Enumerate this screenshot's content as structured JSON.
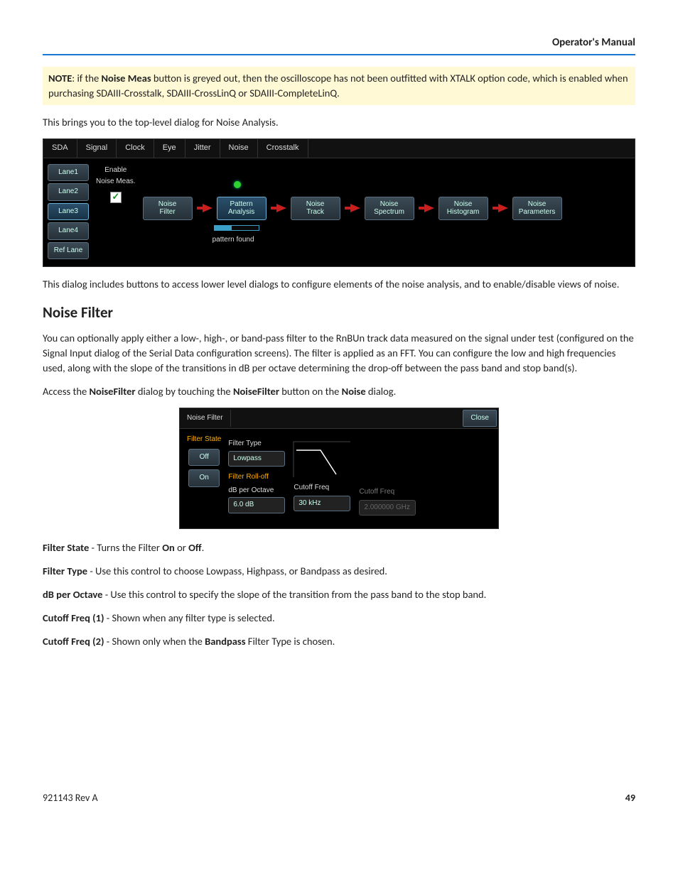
{
  "header": {
    "title": "Operator's Manual"
  },
  "note": {
    "prefix": "NOTE",
    "text1": ": if the ",
    "bold1": "Noise Meas",
    "text2": " button is greyed out, then the oscilloscope has not been outfitted with XTALK option code, which is enabled when purchasing SDAIII-Crosstalk, SDAIII-CrossLinQ or SDAIII-CompleteLinQ."
  },
  "p_intro": "This brings you to the top-level dialog for Noise Analysis.",
  "shot1": {
    "tabs": [
      "SDA",
      "Signal",
      "Clock",
      "Eye",
      "Jitter",
      "Noise",
      "Crosstalk"
    ],
    "lanes": [
      "Lane1",
      "Lane2",
      "Lane3",
      "Lane4",
      "Ref Lane"
    ],
    "selected_lane_index": 2,
    "enable_label1": "Enable",
    "enable_label2": "Noise Meas.",
    "checked": true,
    "flow_buttons": [
      "Noise\nFilter",
      "Pattern\nAnalysis",
      "Noise\nTrack",
      "Noise\nSpectrum",
      "Noise\nHistogram",
      "Noise\nParameters"
    ],
    "active_flow_index": 1,
    "pattern_found": "pattern found"
  },
  "p_after1": "This dialog includes buttons to access lower level dialogs to configure elements of the noise analysis, and to enable/disable views of noise.",
  "h_filter": "Noise Filter",
  "p_filter_desc": "You can optionally apply either a low-, high-, or band-pass filter to the RnBUn track data measured on the signal under test (configured on the Signal Input dialog of the Serial Data configuration screens). The filter is applied as an FFT. You can configure the low and high frequencies used, along with the slope of the transitions in dB per octave determining the drop-off between the pass band and stop band(s).",
  "p_access": {
    "pre": "Access the ",
    "b1": "NoiseFilter",
    "mid1": " dialog by touching the ",
    "b2": "NoiseFilter",
    "mid2": " button on the ",
    "b3": "Noise",
    "post": " dialog."
  },
  "shot2": {
    "title": "Noise Filter",
    "close": "Close",
    "filter_state": "Filter State",
    "off": "Off",
    "on": "On",
    "filter_type_lbl": "Filter Type",
    "filter_type_val": "Lowpass",
    "rolloff_lbl": "Filter Roll-off",
    "db_lbl": "dB per Octave",
    "db_val": "6.0 dB",
    "cutoff1_lbl": "Cutoff Freq",
    "cutoff1_val": "30 kHz",
    "cutoff2_lbl": "Cutoff Freq",
    "cutoff2_val": "2.000000 GHz"
  },
  "defs": {
    "filter_state": {
      "label": "Filter State",
      "text1": " - Turns the Filter ",
      "b1": "On",
      "mid": " or ",
      "b2": "Off",
      "end": "."
    },
    "filter_type": {
      "label": "Filter Type",
      "text": " - Use this control to choose Lowpass, Highpass, or Bandpass as desired."
    },
    "db": {
      "label": "dB per Octave",
      "text": " - Use this control to specify the slope of the transition from the pass band to the stop band."
    },
    "c1": {
      "label": "Cutoff Freq (1)",
      "text": " - Shown when any filter type is selected."
    },
    "c2": {
      "label": "Cutoff Freq (2)",
      "text1": " - Shown only when the ",
      "b1": "Bandpass",
      "text2": " Filter Type is chosen."
    }
  },
  "footer": {
    "rev": "921143 Rev A",
    "page": "49"
  }
}
